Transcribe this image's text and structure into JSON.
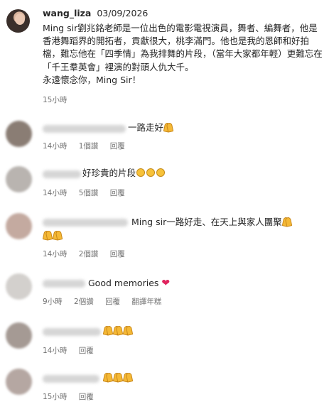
{
  "post": {
    "author": "wang_liza",
    "date": "03/09/2026",
    "caption": "Ming sir劉兆銘老師是一位出色的電影電視演員，舞者、編舞者，他是香港舞蹈界的開拓者，貢獻很大，桃李滿門。他也是我的恩師和好拍檔，難忘他在「四季情」為我排舞的片段，（當年大家都年輕）更難忘在「千王羣英會」裡演的對頭人仇大千。\n永遠懷念你，Ming Sir！",
    "time": "15小時"
  },
  "comments": [
    {
      "text": "一路走好",
      "emoji": "pray",
      "emoji_count": 1,
      "time": "14小時",
      "likes": "1個讚",
      "reply": "回覆",
      "translate": ""
    },
    {
      "text": "好珍貴的片段",
      "emoji": "clap",
      "emoji_count": 3,
      "time": "14小時",
      "likes": "5個讚",
      "reply": "回覆",
      "translate": ""
    },
    {
      "text": "Ming sir一路好走、在天上與家人團聚",
      "emoji": "pray",
      "emoji_count": 3,
      "time": "14小時",
      "likes": "2個讚",
      "reply": "回覆",
      "translate": ""
    },
    {
      "text": "Good memories",
      "emoji": "heart",
      "emoji_count": 1,
      "time": "9小時",
      "likes": "2個讚",
      "reply": "回覆",
      "translate": "翻譯年糕"
    },
    {
      "text": "",
      "emoji": "pray",
      "emoji_count": 3,
      "time": "14小時",
      "likes": "",
      "reply": "回覆",
      "translate": ""
    },
    {
      "text": "",
      "emoji": "pray",
      "emoji_count": 3,
      "time": "15小時",
      "likes": "",
      "reply": "回覆",
      "translate": ""
    }
  ],
  "colors": {
    "text": "#262626",
    "meta": "#737373",
    "heart": "#e0245e"
  }
}
